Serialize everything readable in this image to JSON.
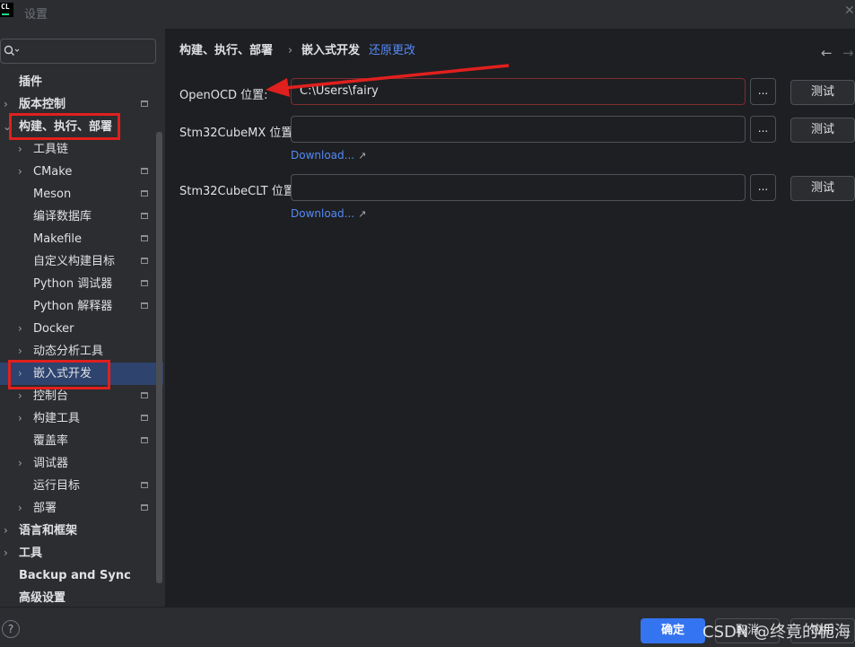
{
  "window": {
    "title": "设置",
    "logo_text": "CL"
  },
  "sidebar": {
    "search_placeholder": "",
    "items": [
      {
        "label": "插件",
        "bold": true
      },
      {
        "label": "版本控制",
        "bold": true
      },
      {
        "label": "构建、执行、部署",
        "bold": true
      },
      {
        "label": "工具链"
      },
      {
        "label": "CMake"
      },
      {
        "label": "Meson"
      },
      {
        "label": "编译数据库"
      },
      {
        "label": "Makefile"
      },
      {
        "label": "自定义构建目标"
      },
      {
        "label": "Python 调试器"
      },
      {
        "label": "Python 解释器"
      },
      {
        "label": "Docker"
      },
      {
        "label": "动态分析工具"
      },
      {
        "label": "嵌入式开发",
        "selected": true
      },
      {
        "label": "控制台"
      },
      {
        "label": "构建工具"
      },
      {
        "label": "覆盖率"
      },
      {
        "label": "调试器"
      },
      {
        "label": "运行目标"
      },
      {
        "label": "部署"
      },
      {
        "label": "语言和框架",
        "bold": true
      },
      {
        "label": "工具",
        "bold": true
      },
      {
        "label": "Backup and Sync",
        "bold": true
      },
      {
        "label": "高级设置",
        "bold": true
      }
    ]
  },
  "content": {
    "breadcrumb": {
      "parent": "构建、执行、部署",
      "separator": "›",
      "current": "嵌入式开发",
      "reset_link": "还原更改"
    },
    "fields": [
      {
        "label": "OpenOCD 位置:",
        "value": "C:\\Users\\fairy",
        "browse": "...",
        "test": "测试"
      },
      {
        "label": "Stm32CubeMX 位置:",
        "value": "",
        "browse": "...",
        "test": "测试",
        "download": "Download..."
      },
      {
        "label": "Stm32CubeCLT 位置:",
        "value": "",
        "browse": "...",
        "test": "测试",
        "download": "Download..."
      }
    ],
    "nav": {
      "back": "←",
      "forward": "→"
    }
  },
  "footer": {
    "help": "?",
    "ok": "确定",
    "cancel": "取消",
    "apply": "应用"
  },
  "watermark": "CSDN @终竟的栀海",
  "annotation_color": "#e0201e"
}
